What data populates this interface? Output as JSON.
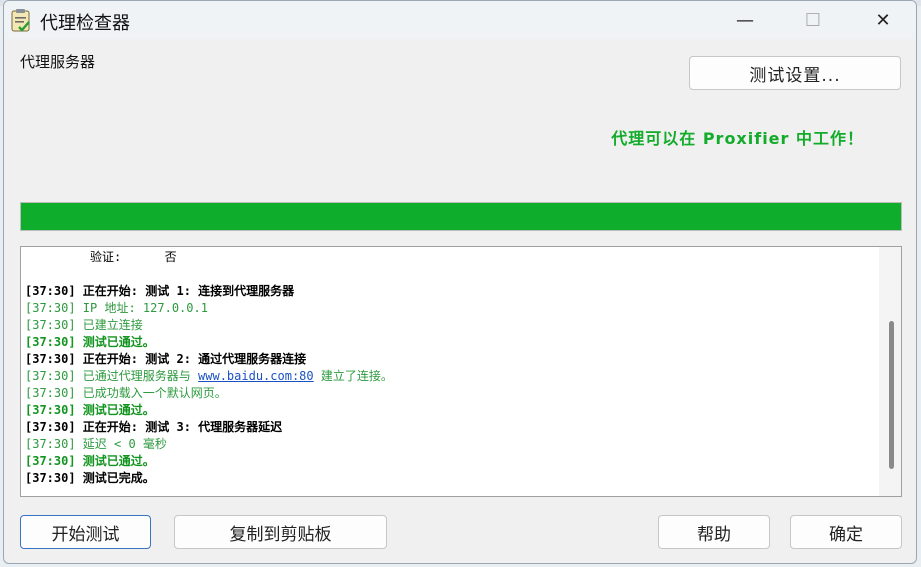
{
  "window": {
    "title": "代理检查器",
    "minimize_glyph": "—",
    "maximize_glyph": "☐",
    "close_glyph": "✕",
    "app_icon": "clipboard-check-icon"
  },
  "main": {
    "proxy_label": "代理服务器",
    "settings_button": "测试设置...",
    "status_message": "代理可以在 Proxifier 中工作！",
    "status_color": "#12ab2a",
    "progress_fraction": 1.0,
    "progress_color": "#0fad2c"
  },
  "log": {
    "lines": [
      {
        "text": "         验证:      否",
        "style": "black"
      },
      {
        "text": "",
        "style": "blank"
      },
      {
        "text": "[37:30] 正在开始: 测试 1: 连接到代理服务器",
        "style": "black bold"
      },
      {
        "text": "[37:30] IP 地址: 127.0.0.1",
        "style": "green"
      },
      {
        "text": "[37:30] 已建立连接",
        "style": "green"
      },
      {
        "text": "[37:30] 测试已通过。",
        "style": "green bold"
      },
      {
        "text": "[37:30] 正在开始: 测试 2: 通过代理服务器连接",
        "style": "black bold"
      },
      {
        "text_before": "[37:30] 已通过代理服务器与 ",
        "link": "www.baidu.com:80",
        "text_after": " 建立了连接。",
        "style": "green"
      },
      {
        "text": "[37:30] 已成功载入一个默认网页。",
        "style": "green"
      },
      {
        "text": "[37:30] 测试已通过。",
        "style": "green bold"
      },
      {
        "text": "[37:30] 正在开始: 测试 3: 代理服务器延迟",
        "style": "black bold"
      },
      {
        "text": "[37:30] 延迟 < 0 毫秒",
        "style": "green"
      },
      {
        "text": "[37:30] 测试已通过。",
        "style": "green bold"
      },
      {
        "text": "[37:30] 测试已完成。",
        "style": "black bold"
      }
    ]
  },
  "footer": {
    "start_button": "开始测试",
    "copy_button": "复制到剪贴板",
    "help_button": "帮助",
    "ok_button": "确定"
  }
}
